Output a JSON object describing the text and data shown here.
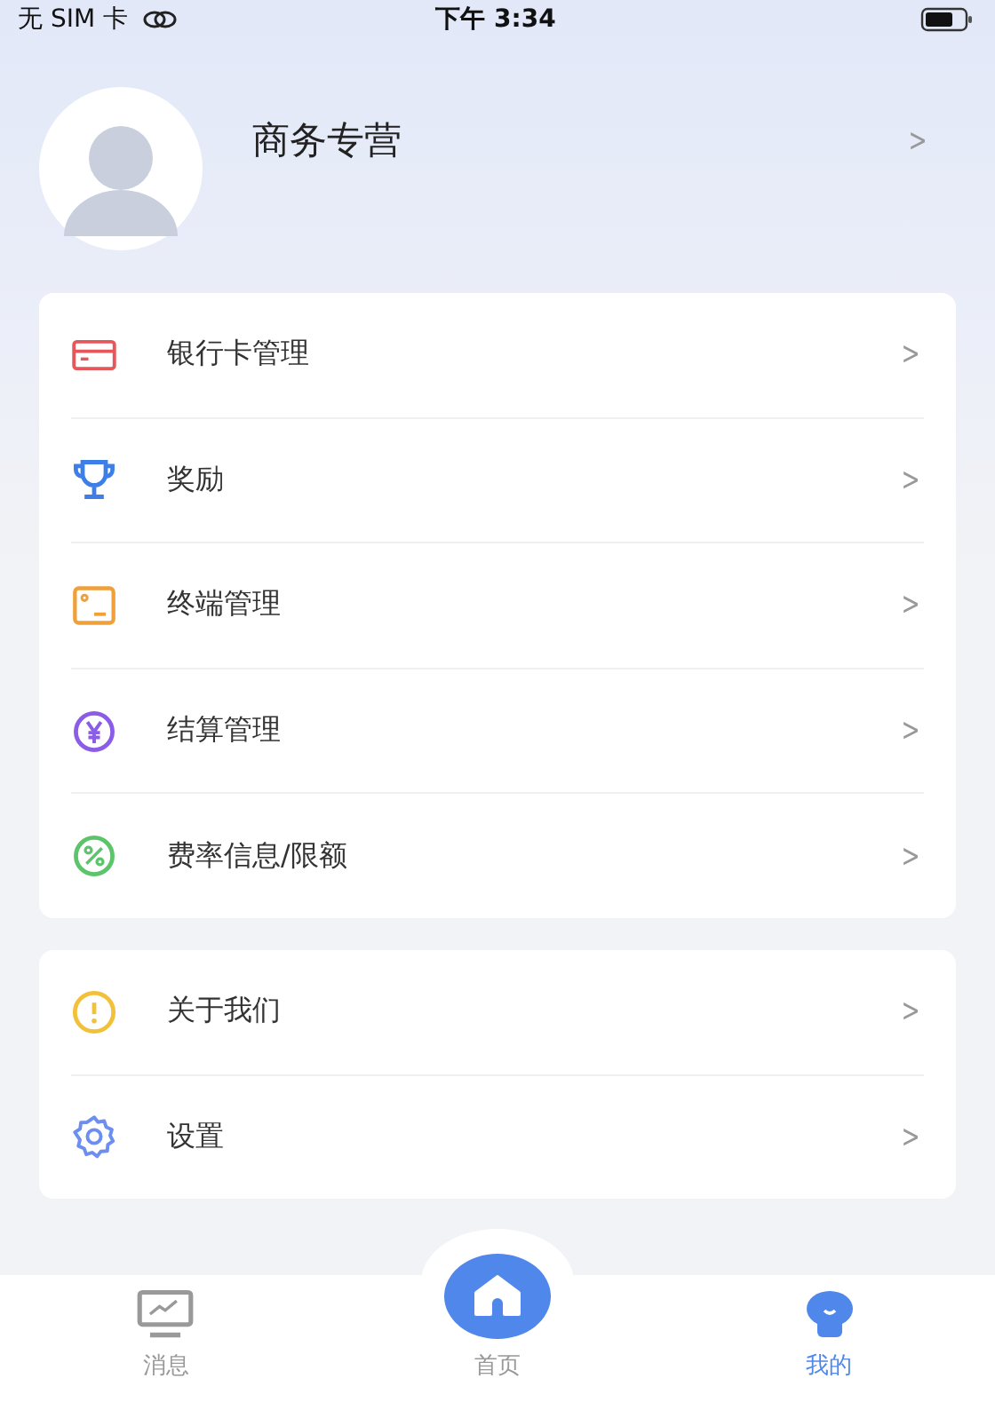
{
  "status_bar": {
    "carrier": "无 SIM 卡",
    "time": "下午 3:34"
  },
  "profile": {
    "name": "商务专营",
    "chevron": ">"
  },
  "menu_groups": [
    {
      "items": [
        {
          "kind": "card",
          "label": "银行卡管理",
          "chevron": ">"
        },
        {
          "kind": "trophy",
          "label": "奖励",
          "chevron": ">"
        },
        {
          "kind": "terminal",
          "label": "终端管理",
          "chevron": ">"
        },
        {
          "kind": "yen",
          "label": "结算管理",
          "chevron": ">"
        },
        {
          "kind": "percent",
          "label": "费率信息/限额",
          "chevron": ">"
        }
      ]
    },
    {
      "items": [
        {
          "kind": "info",
          "label": "关于我们",
          "chevron": ">"
        },
        {
          "kind": "gear",
          "label": "设置",
          "chevron": ">"
        }
      ]
    }
  ],
  "tab_bar": [
    {
      "kind": "monitor",
      "label": "消息",
      "selected": false
    },
    {
      "kind": "home",
      "label": "首页",
      "selected": false
    },
    {
      "kind": "mascot",
      "label": "我的",
      "selected": true
    }
  ]
}
